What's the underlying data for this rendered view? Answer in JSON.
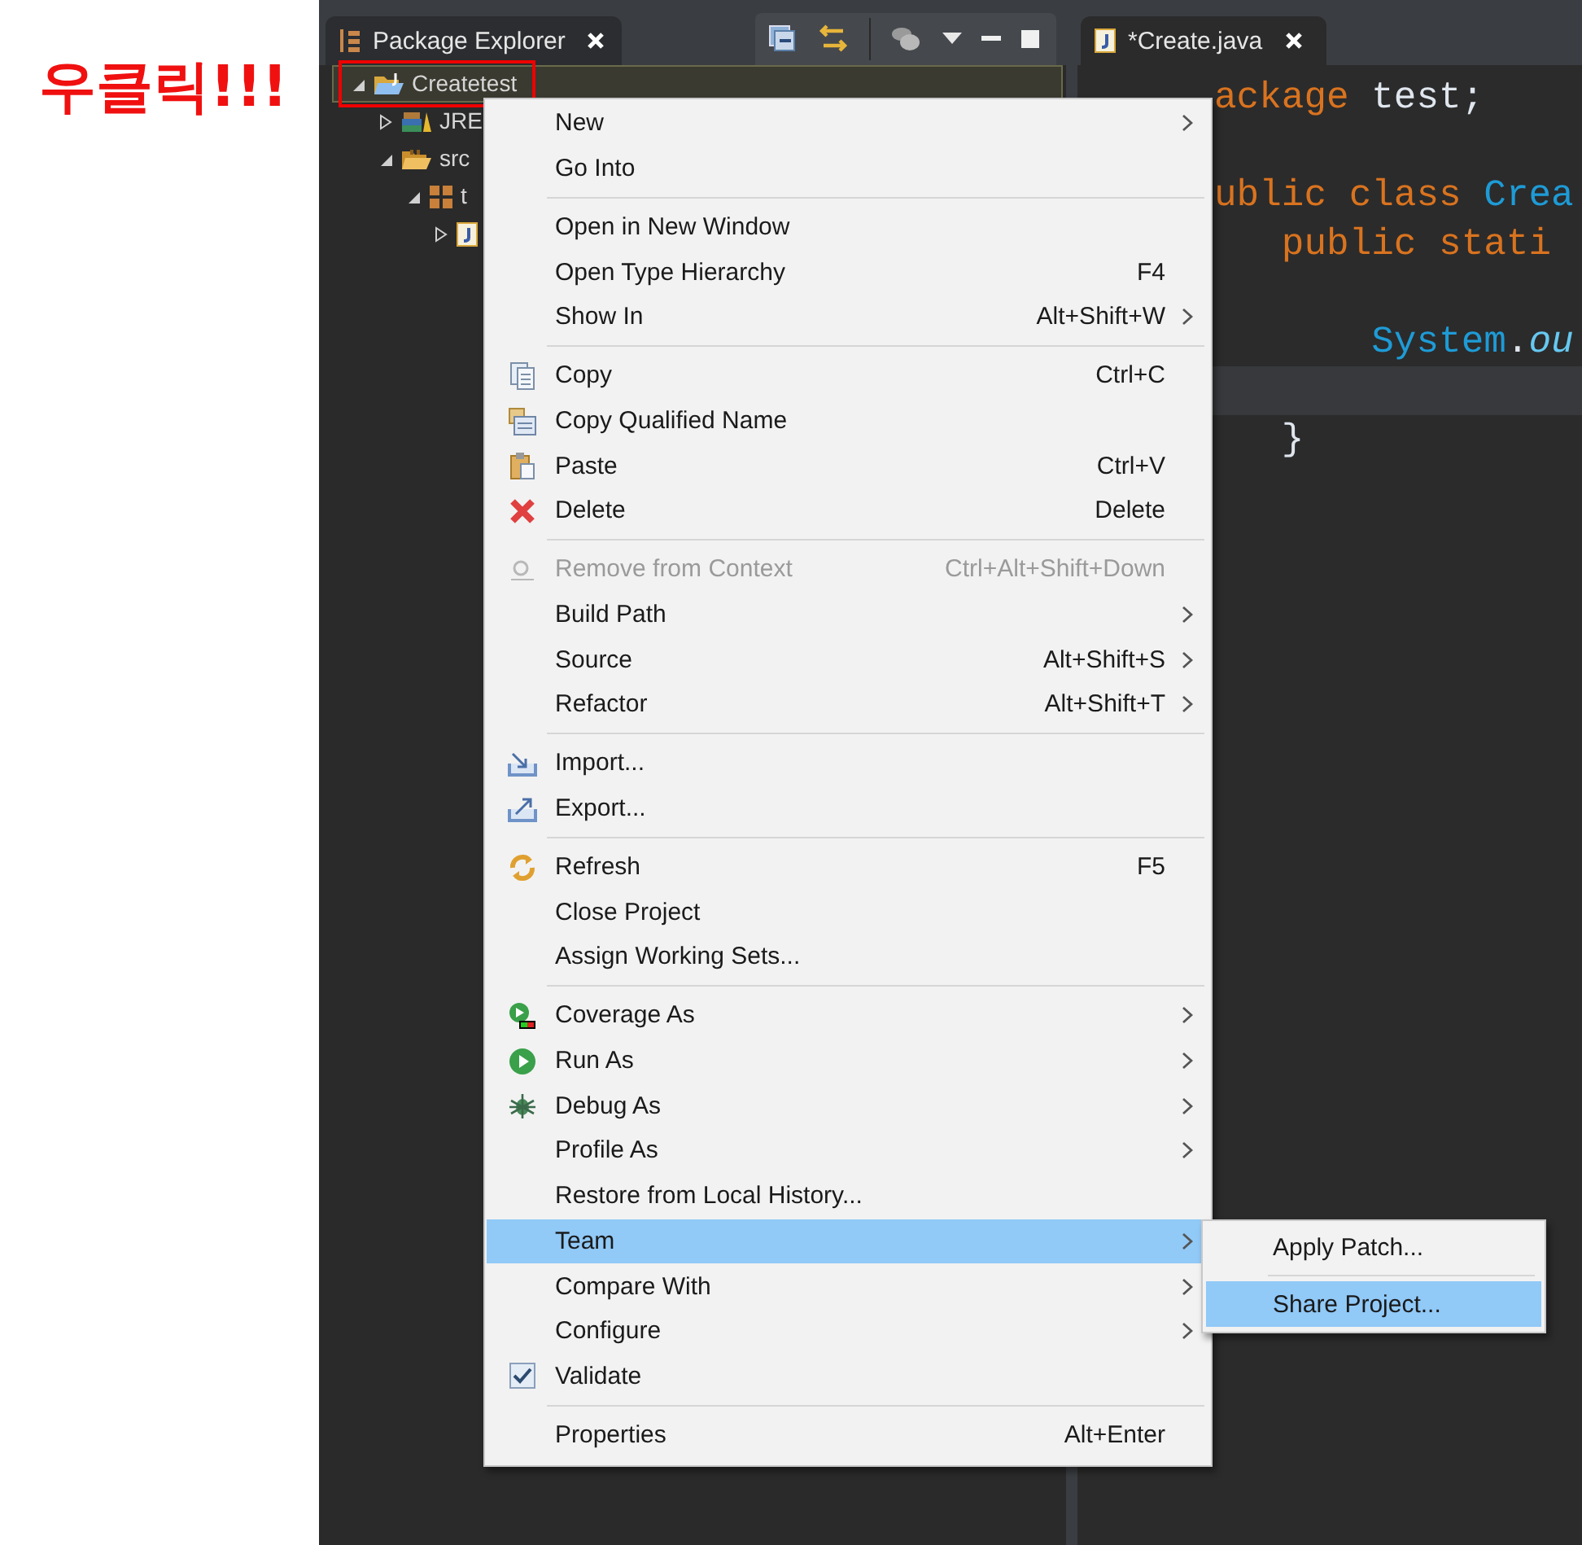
{
  "annotation": {
    "text": "우클릭!!!"
  },
  "explorer": {
    "title": "Package Explorer",
    "tree": [
      {
        "label": "Createtest",
        "kind": "project",
        "expanded": true,
        "selected": true,
        "children": [
          {
            "label": "JRE",
            "kind": "library",
            "expanded": false,
            "selected": false
          },
          {
            "label": "src",
            "kind": "folder",
            "expanded": true,
            "selected": false,
            "children": [
              {
                "label": "t",
                "kind": "package",
                "expanded": true,
                "selected": false,
                "children": [
                  {
                    "kind": "java-file",
                    "expanded": false,
                    "selected": false
                  }
                ]
              }
            ]
          }
        ]
      }
    ]
  },
  "editor": {
    "tab": {
      "title": "*Create.java"
    },
    "lines": [
      {
        "current": false,
        "tokens": [
          {
            "text": "ackage",
            "kind": "keyword"
          },
          {
            "text": " test;",
            "kind": "plain"
          }
        ]
      },
      {
        "current": false
      },
      {
        "current": false,
        "tokens": [
          {
            "text": "ublic class ",
            "kind": "keyword"
          },
          {
            "text": "Crea",
            "kind": "type"
          }
        ]
      },
      {
        "current": false,
        "tokens": [
          {
            "text": "   public stati",
            "kind": "keyword"
          }
        ]
      },
      {
        "current": false
      },
      {
        "current": false,
        "tokens": [
          {
            "text": "       System",
            "kind": "type"
          },
          {
            "text": ".",
            "kind": "plain"
          },
          {
            "text": "ou",
            "kind": "field"
          }
        ]
      },
      {
        "current": true
      },
      {
        "current": false,
        "tokens": [
          {
            "text": "   }",
            "kind": "plain"
          }
        ]
      }
    ]
  },
  "context_menu": {
    "items": [
      {
        "kind": "item",
        "label": "New",
        "submenu": true,
        "disabled": false,
        "selected": false
      },
      {
        "kind": "item",
        "label": "Go Into",
        "submenu": false,
        "disabled": false,
        "selected": false
      },
      {
        "kind": "separator"
      },
      {
        "kind": "item",
        "label": "Open in New Window",
        "submenu": false,
        "disabled": false,
        "selected": false
      },
      {
        "kind": "item",
        "label": "Open Type Hierarchy",
        "shortcut": "F4",
        "submenu": false,
        "disabled": false,
        "selected": false
      },
      {
        "kind": "item",
        "label": "Show In",
        "shortcut": "Alt+Shift+W",
        "submenu": true,
        "disabled": false,
        "selected": false
      },
      {
        "kind": "separator"
      },
      {
        "kind": "item",
        "label": "Copy",
        "shortcut": "Ctrl+C",
        "submenu": false,
        "disabled": false,
        "selected": false
      },
      {
        "kind": "item",
        "label": "Copy Qualified Name",
        "submenu": false,
        "disabled": false,
        "selected": false
      },
      {
        "kind": "item",
        "label": "Paste",
        "shortcut": "Ctrl+V",
        "submenu": false,
        "disabled": false,
        "selected": false
      },
      {
        "kind": "item",
        "label": "Delete",
        "shortcut": "Delete",
        "submenu": false,
        "disabled": false,
        "selected": false
      },
      {
        "kind": "separator"
      },
      {
        "kind": "item",
        "label": "Remove from Context",
        "shortcut": "Ctrl+Alt+Shift+Down",
        "submenu": false,
        "disabled": true,
        "selected": false
      },
      {
        "kind": "item",
        "label": "Build Path",
        "submenu": true,
        "disabled": false,
        "selected": false
      },
      {
        "kind": "item",
        "label": "Source",
        "shortcut": "Alt+Shift+S",
        "submenu": true,
        "disabled": false,
        "selected": false
      },
      {
        "kind": "item",
        "label": "Refactor",
        "shortcut": "Alt+Shift+T",
        "submenu": true,
        "disabled": false,
        "selected": false
      },
      {
        "kind": "separator"
      },
      {
        "kind": "item",
        "label": "Import...",
        "submenu": false,
        "disabled": false,
        "selected": false
      },
      {
        "kind": "item",
        "label": "Export...",
        "submenu": false,
        "disabled": false,
        "selected": false
      },
      {
        "kind": "separator"
      },
      {
        "kind": "item",
        "label": "Refresh",
        "shortcut": "F5",
        "submenu": false,
        "disabled": false,
        "selected": false
      },
      {
        "kind": "item",
        "label": "Close Project",
        "submenu": false,
        "disabled": false,
        "selected": false
      },
      {
        "kind": "item",
        "label": "Assign Working Sets...",
        "submenu": false,
        "disabled": false,
        "selected": false
      },
      {
        "kind": "separator"
      },
      {
        "kind": "item",
        "label": "Coverage As",
        "submenu": true,
        "disabled": false,
        "selected": false
      },
      {
        "kind": "item",
        "label": "Run As",
        "submenu": true,
        "disabled": false,
        "selected": false
      },
      {
        "kind": "item",
        "label": "Debug As",
        "submenu": true,
        "disabled": false,
        "selected": false
      },
      {
        "kind": "item",
        "label": "Profile As",
        "submenu": true,
        "disabled": false,
        "selected": false
      },
      {
        "kind": "item",
        "label": "Restore from Local History...",
        "submenu": false,
        "disabled": false,
        "selected": false
      },
      {
        "kind": "item",
        "label": "Team",
        "submenu": true,
        "disabled": false,
        "selected": true
      },
      {
        "kind": "item",
        "label": "Compare With",
        "submenu": true,
        "disabled": false,
        "selected": false
      },
      {
        "kind": "item",
        "label": "Configure",
        "submenu": true,
        "disabled": false,
        "selected": false
      },
      {
        "kind": "check",
        "label": "Validate",
        "checked": true,
        "submenu": false,
        "disabled": false,
        "selected": false
      },
      {
        "kind": "separator"
      },
      {
        "kind": "item",
        "label": "Properties",
        "shortcut": "Alt+Enter",
        "submenu": false,
        "disabled": false,
        "selected": false
      }
    ]
  },
  "submenu": {
    "items": [
      {
        "kind": "item",
        "label": "Apply Patch...",
        "selected": false
      },
      {
        "kind": "separator"
      },
      {
        "kind": "item",
        "label": "Share Project...",
        "selected": true
      }
    ]
  }
}
